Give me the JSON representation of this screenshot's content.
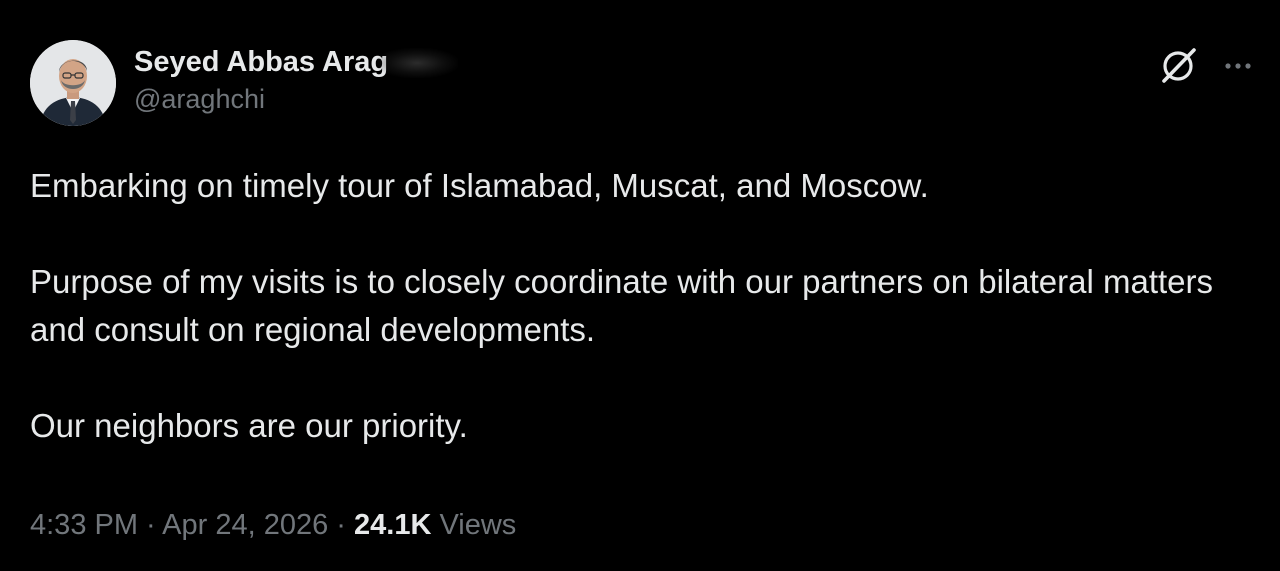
{
  "author": {
    "display_name": "Seyed Abbas Arag",
    "handle": "@araghchi"
  },
  "icons": {
    "grok": "grok-icon",
    "more": "more-icon"
  },
  "tweet": {
    "paragraphs": [
      "Embarking on timely tour of Islamabad, Muscat, and Moscow.",
      "Purpose of my visits is to closely coordinate with our partners on bilateral matters and consult on regional developments.",
      "Our neighbors are our priority."
    ]
  },
  "meta": {
    "time": "4:33 PM",
    "separator": " · ",
    "date": "Apr 24, 2026",
    "views_count": "24.1K",
    "views_label": " Views"
  },
  "colors": {
    "background": "#000000",
    "primary_text": "#e7e9ea",
    "secondary_text": "#71767b"
  }
}
